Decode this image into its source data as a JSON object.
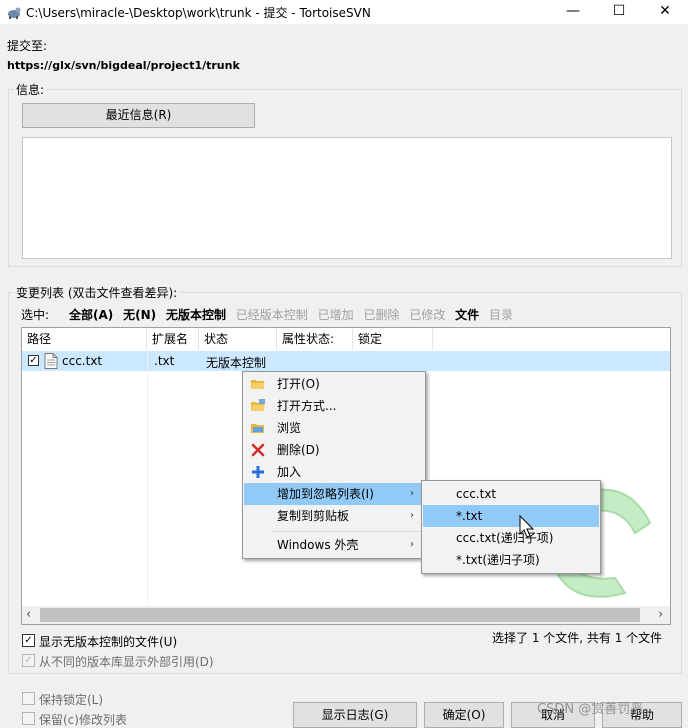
{
  "window": {
    "title": "C:\\Users\\miracle-\\Desktop\\work\\trunk - 提交 - TortoiseSVN",
    "minimize_glyph": "—",
    "maximize_glyph": "☐",
    "close_glyph": "✕"
  },
  "commit_to_label": "提交至:",
  "commit_url": "https://glx/svn/bigdeal/project1/trunk",
  "message": {
    "group_label": "信息:",
    "recent_button": "最近信息(R)",
    "value": ""
  },
  "changes": {
    "group_label": "变更列表 (双击文件查看差异):",
    "select_label": "选中:",
    "filters": [
      {
        "label": "全部(A)",
        "enabled": true
      },
      {
        "label": "无(N)",
        "enabled": true
      },
      {
        "label": "无版本控制",
        "enabled": true
      },
      {
        "label": "已经版本控制",
        "enabled": false
      },
      {
        "label": "已增加",
        "enabled": false
      },
      {
        "label": "已删除",
        "enabled": false
      },
      {
        "label": "已修改",
        "enabled": false
      },
      {
        "label": "文件",
        "enabled": true
      },
      {
        "label": "目录",
        "enabled": false
      }
    ],
    "columns": [
      "路径",
      "扩展名",
      "状态",
      "属性状态:",
      "锁定"
    ],
    "rows": [
      {
        "checked": true,
        "check_glyph": "✓",
        "path": "ccc.txt",
        "ext": ".txt",
        "status": "无版本控制",
        "prop_status": "",
        "lock": ""
      }
    ],
    "scroll_left": "‹",
    "scroll_right": "›"
  },
  "context_menu": {
    "items": [
      {
        "label": "打开(O)",
        "icon": "open-folder-icon"
      },
      {
        "label": "打开方式...",
        "icon": "open-with-icon"
      },
      {
        "label": "浏览",
        "icon": "explore-icon"
      },
      {
        "label": "删除(D)",
        "icon": "delete-icon"
      },
      {
        "label": "加入",
        "icon": "add-icon"
      },
      {
        "label": "增加到忽略列表(I)",
        "submenu": true,
        "highlighted": true
      },
      {
        "label": "复制到剪贴板",
        "submenu": true
      },
      {
        "label": "Windows 外壳",
        "submenu": true
      }
    ],
    "submenu_arrow": "›"
  },
  "submenu": {
    "items": [
      {
        "label": "ccc.txt"
      },
      {
        "label": "*.txt",
        "highlighted": true
      },
      {
        "label": "ccc.txt(递归子项)"
      },
      {
        "label": "*.txt(递归子项)"
      }
    ]
  },
  "options": {
    "show_unversioned": {
      "label": "显示无版本控制的文件(U)",
      "checked": true,
      "enabled": true
    },
    "show_externals": {
      "label": "从不同的版本库显示外部引用(D)",
      "checked": true,
      "enabled": false
    },
    "keep_locks": {
      "label": "保持锁定(L)",
      "checked": false,
      "enabled": false
    },
    "keep_changelists": {
      "label": "保留(c)修改列表",
      "checked": false,
      "enabled": false
    }
  },
  "selection_summary": "选择了 1 个文件, 共有 1 个文件",
  "buttons": {
    "show_log": "显示日志(G)",
    "ok": "确定(O)",
    "cancel": "取消",
    "help": "帮助"
  },
  "watermark": "CSDN @赏善罚恶",
  "colors": {
    "selection": "#cce8ff",
    "menu_highlight": "#91c9f7",
    "disabled_text": "#a0a0a0"
  }
}
